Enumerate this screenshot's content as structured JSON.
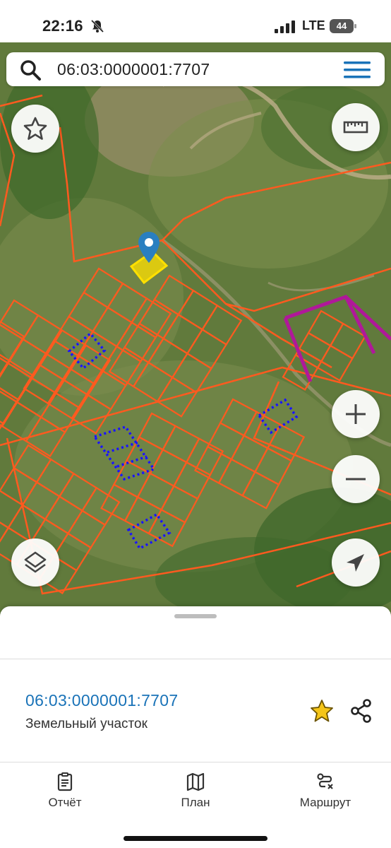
{
  "status_bar": {
    "time": "22:16",
    "network": "LTE",
    "battery": "44"
  },
  "search": {
    "query": "06:03:0000001:7707"
  },
  "map": {
    "parcel_outline_color": "#ff5a1f",
    "selected_parcel_color": "#ffe000",
    "highlight_dotted_color": "#1a14ff",
    "zone_color": "#b0189a",
    "marker_color": "#2a7fc0",
    "buttons": [
      "star-icon",
      "ruler-icon",
      "zoom-in-icon",
      "zoom-out-icon",
      "layers-icon",
      "locate-icon"
    ]
  },
  "parcel": {
    "id": "06:03:0000001:7707",
    "type": "Земельный участок"
  },
  "tabs": [
    {
      "label": "Отчёт",
      "icon": "report-icon"
    },
    {
      "label": "План",
      "icon": "map-plan-icon"
    },
    {
      "label": "Маршрут",
      "icon": "route-icon"
    }
  ],
  "colors": {
    "accent": "#1a73b8",
    "favorite": "#f5c518"
  }
}
